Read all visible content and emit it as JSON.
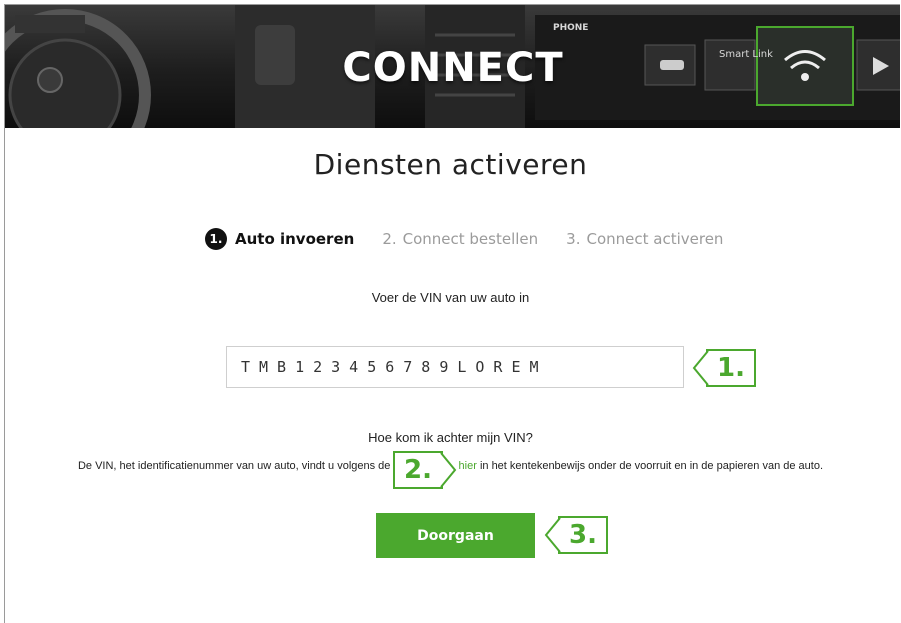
{
  "hero": {
    "title": "CONNECT",
    "labels": {
      "phone": "PHONE",
      "smartlink": "Smart Link"
    }
  },
  "page": {
    "title": "Diensten activeren"
  },
  "steps": [
    {
      "number": "1.",
      "label": "Auto invoeren",
      "state": "active"
    },
    {
      "number": "2.",
      "label": "Connect bestellen",
      "state": "inactive"
    },
    {
      "number": "3.",
      "label": "Connect activeren",
      "state": "inactive"
    }
  ],
  "form": {
    "instruction": "Voer de VIN van uw auto in",
    "vin_value": "TMB123456789LOREM"
  },
  "help": {
    "title": "Hoe kom ik achter mijn VIN?",
    "text_before": "De VIN, het identificatienummer van uw auto, vindt u volgens de",
    "link": "hier",
    "text_after": " in het kentekenbewijs onder de voorruit en in de papieren van de auto."
  },
  "actions": {
    "continue_label": "Doorgaan"
  },
  "callouts": {
    "one": "1.",
    "two": "2.",
    "three": "3."
  },
  "colors": {
    "accent": "#4ba82e",
    "hero_bg": "#1d1d1d"
  }
}
